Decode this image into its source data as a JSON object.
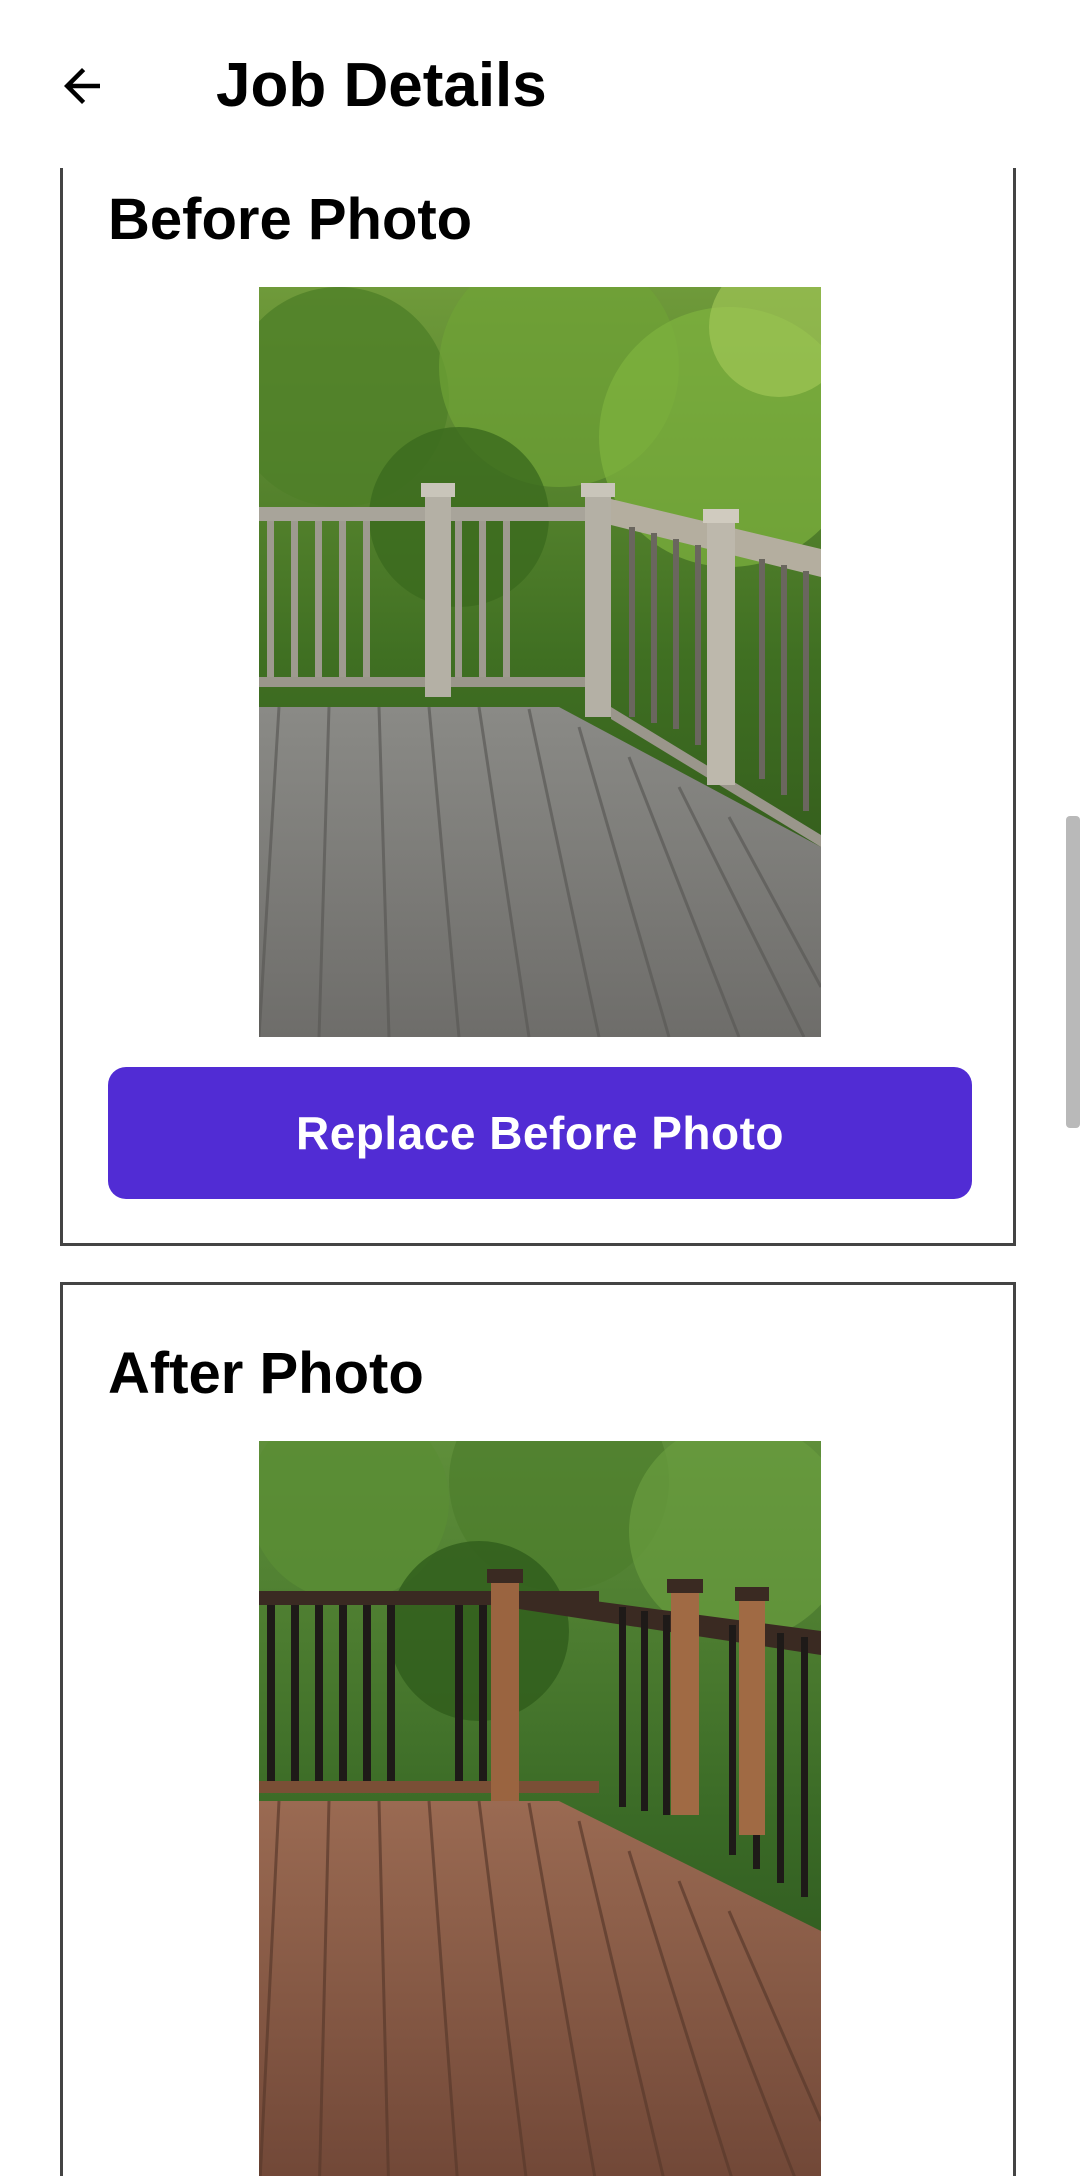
{
  "app_bar": {
    "title": "Job Details",
    "back_icon": "arrow-left-icon"
  },
  "before_section": {
    "title": "Before Photo",
    "photo_icon": "weathered-deck-photo",
    "button_label": "Replace Before Photo"
  },
  "after_section": {
    "title": "After Photo",
    "photo_icon": "stained-deck-photo"
  },
  "colors": {
    "primary": "#512cd4",
    "card_border": "#444444",
    "scrollbar": "#b9b9b9"
  }
}
